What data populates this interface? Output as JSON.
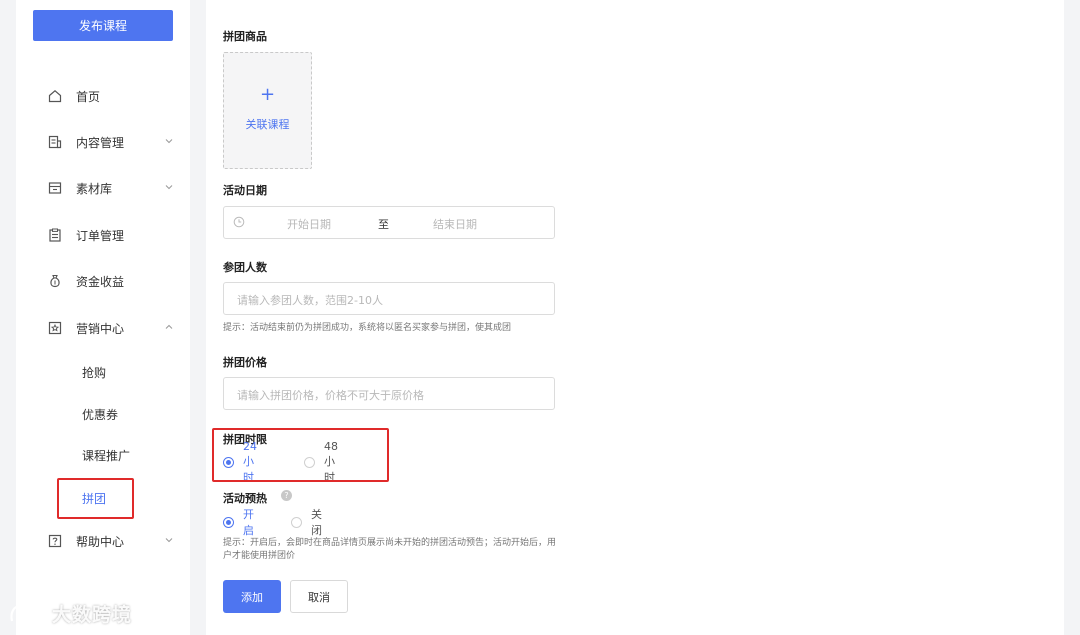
{
  "sidebar": {
    "publish_button": "发布课程",
    "items": [
      {
        "label": "首页",
        "icon": "home-icon"
      },
      {
        "label": "内容管理",
        "icon": "content-icon",
        "chevron": "chevron-down-icon"
      },
      {
        "label": "素材库",
        "icon": "folder-icon",
        "chevron": "chevron-down-icon"
      },
      {
        "label": "订单管理",
        "icon": "clipboard-icon"
      },
      {
        "label": "资金收益",
        "icon": "money-bag-icon"
      },
      {
        "label": "营销中心",
        "icon": "marketing-icon",
        "chevron": "chevron-up-icon"
      },
      {
        "label": "帮助中心",
        "icon": "help-icon",
        "chevron": "chevron-down-icon"
      }
    ],
    "sub_items": [
      "抢购",
      "优惠券",
      "课程推广",
      "拼团"
    ],
    "active_sub_item": "拼团"
  },
  "form": {
    "product": {
      "label": "拼团商品",
      "upload_text": "关联课程",
      "upload_icon": "plus-icon"
    },
    "date": {
      "label": "活动日期",
      "start_placeholder": "开始日期",
      "separator": "至",
      "end_placeholder": "结束日期",
      "icon": "clock-icon"
    },
    "members": {
      "label": "参团人数",
      "placeholder": "请输入参团人数，范围2-10人",
      "hint": "提示：活动结束前仍为拼团成功，系统将以匿名买家参与拼团，使其成团"
    },
    "price": {
      "label": "拼团价格",
      "placeholder": "请输入拼团价格，价格不可大于原价格"
    },
    "time_limit": {
      "label": "拼团时限",
      "options": [
        "24小时",
        "48小时"
      ],
      "selected": "24小时"
    },
    "preheat": {
      "label": "活动预热",
      "help_icon": "question-circle-icon",
      "help_glyph": "?",
      "options": [
        "开启",
        "关闭"
      ],
      "selected": "开启",
      "hint_line1": "提示：开启后，会即时在商品详情页展示尚未开始的拼团活动预告；活动开始后，用",
      "hint_line2": "户才能使用拼团价"
    },
    "buttons": {
      "submit": "添加",
      "cancel": "取消"
    }
  },
  "watermark": {
    "text": "大数跨境",
    "icon": "watermark-logo-icon"
  },
  "colors": {
    "accent": "#4e75f0",
    "highlight_border": "#e02a2a"
  }
}
